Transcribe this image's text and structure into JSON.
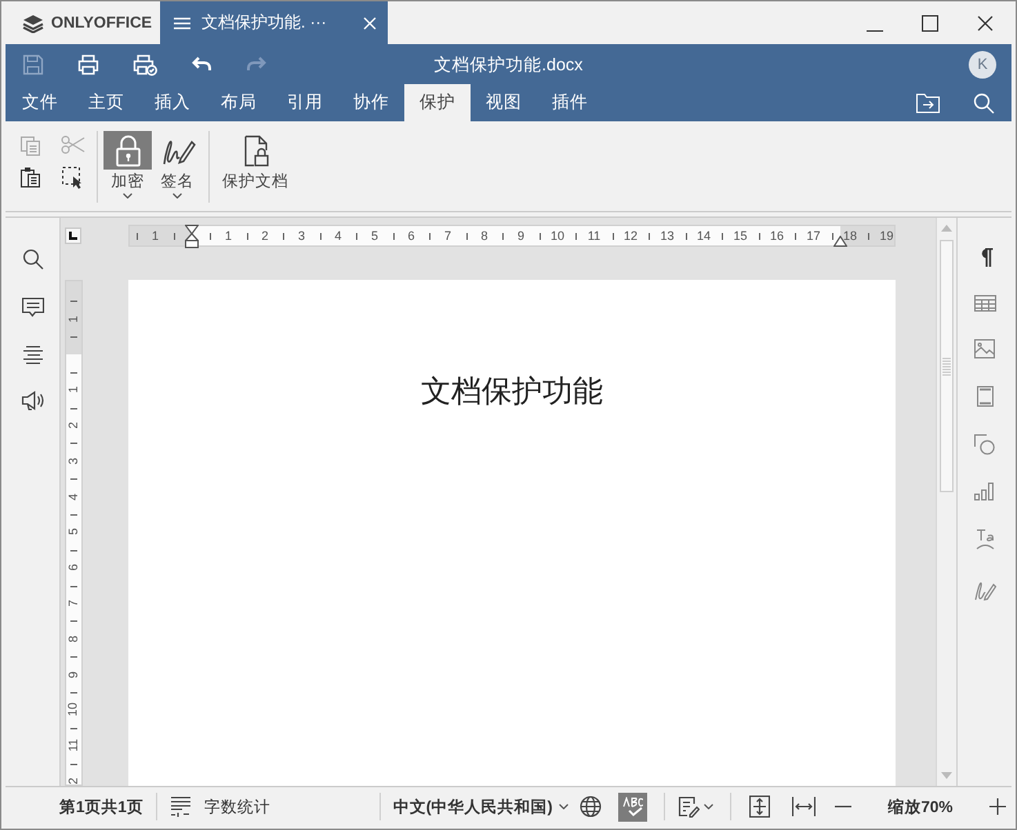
{
  "title_bar": {
    "logo": "ONLYOFFICE",
    "document_tab": "文档保护功能. ···"
  },
  "header": {
    "title": "文档保护功能.docx",
    "avatar": "K"
  },
  "menu_tabs": [
    {
      "label": "文件",
      "selected": false
    },
    {
      "label": "主页",
      "selected": false
    },
    {
      "label": "插入",
      "selected": false
    },
    {
      "label": "布局",
      "selected": false
    },
    {
      "label": "引用",
      "selected": false
    },
    {
      "label": "协作",
      "selected": false
    },
    {
      "label": "保护",
      "selected": true
    },
    {
      "label": "视图",
      "selected": false
    },
    {
      "label": "插件",
      "selected": false
    }
  ],
  "ribbon": {
    "buttons": [
      {
        "kind": "lock",
        "label": "加密",
        "pressed": true,
        "dropdown": true
      },
      {
        "kind": "signature",
        "label": "签名",
        "pressed": false,
        "dropdown": true
      },
      {
        "kind": "protect",
        "label": "保护文档",
        "pressed": false,
        "dropdown": false
      }
    ]
  },
  "ruler": {
    "horizontal": [
      "1",
      "1",
      "2",
      "3",
      "4",
      "5",
      "6",
      "7",
      "8",
      "9",
      "10",
      "11",
      "12",
      "13",
      "14",
      "15",
      "16",
      "17",
      "18",
      "19"
    ],
    "vertical": [
      "1",
      "1",
      "2",
      "3",
      "4",
      "5",
      "6",
      "7",
      "8",
      "9",
      "10",
      "11",
      "2"
    ]
  },
  "document": {
    "heading": "文档保护功能"
  },
  "status_bar": {
    "page": "第1页共1页",
    "word_count": "字数统计",
    "language": "中文(中华人民共和国)",
    "spellcheck_on": true,
    "zoom": "缩放70%"
  }
}
